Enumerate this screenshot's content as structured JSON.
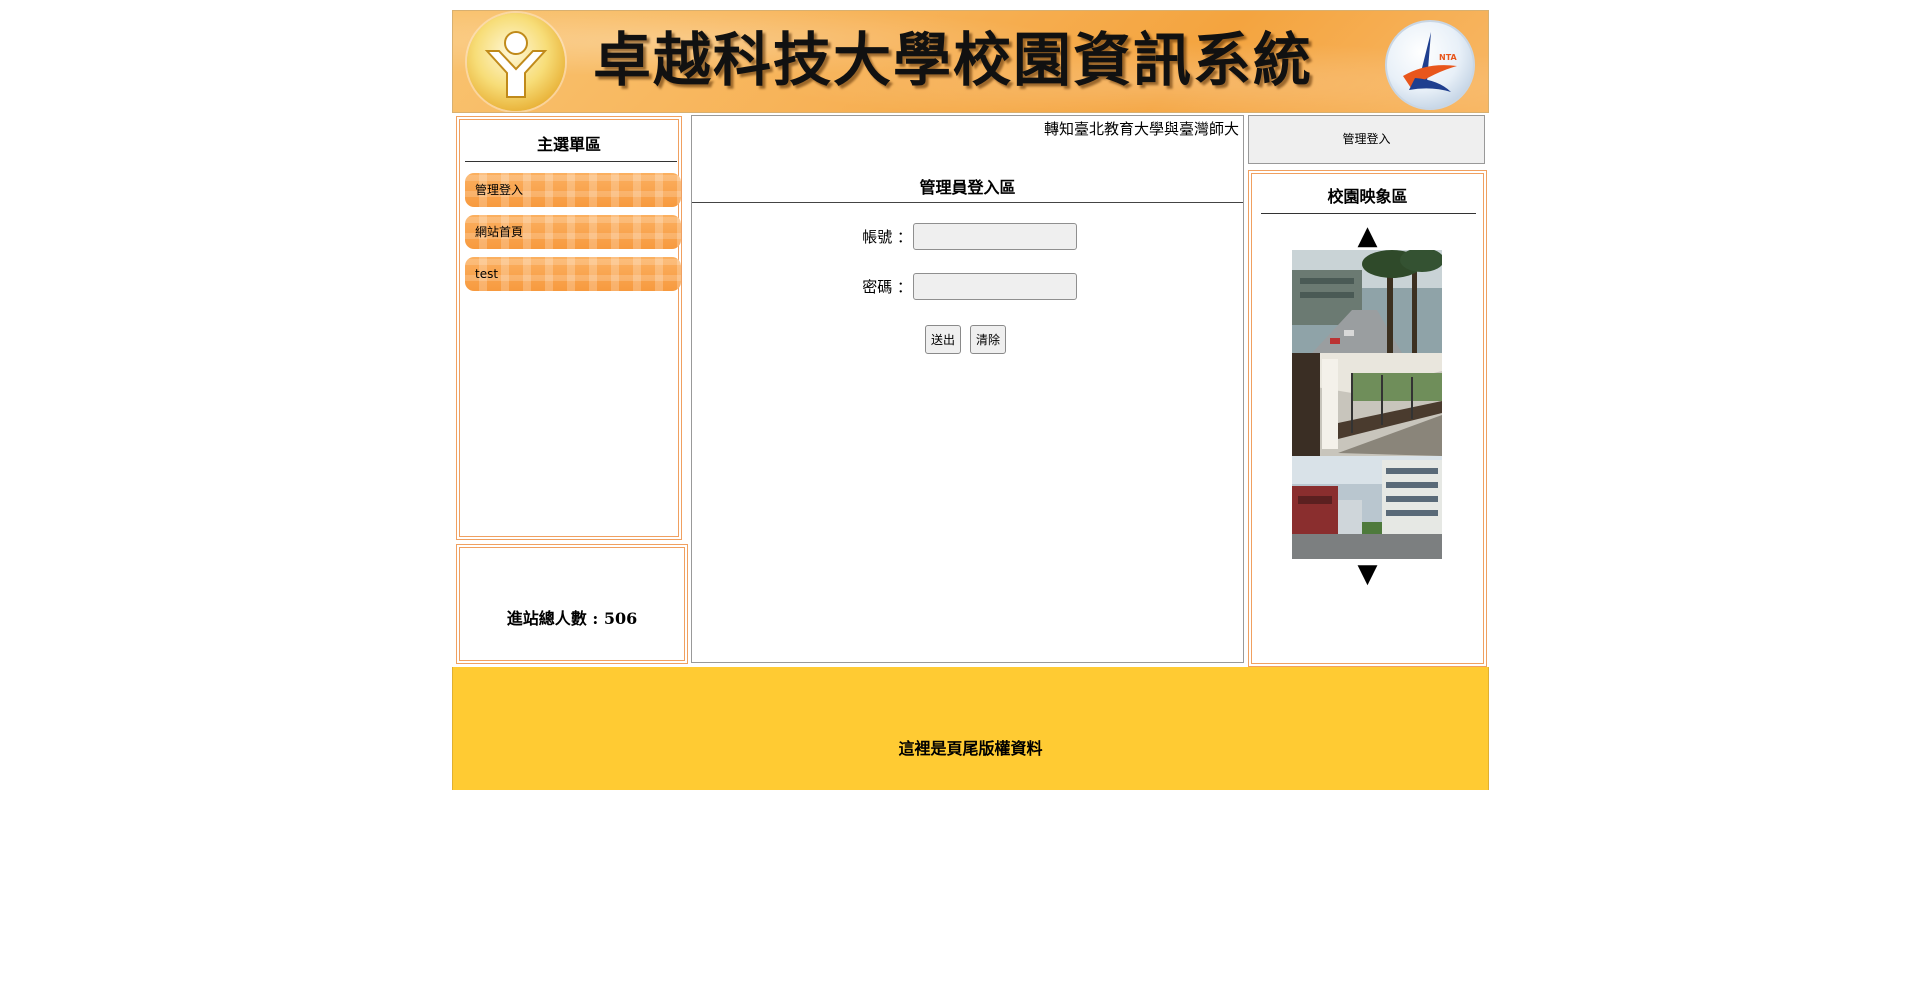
{
  "header": {
    "site_title": "卓越科技大學校園資訊系統",
    "logo_left": "school-emblem-icon",
    "logo_right": "partner-emblem-icon"
  },
  "menu": {
    "title": "主選單區",
    "items": [
      {
        "label": "管理登入"
      },
      {
        "label": "網站首頁"
      },
      {
        "label": "test"
      }
    ]
  },
  "visitor": {
    "label": "進站總人數 : 506"
  },
  "center": {
    "marquee": "轉知臺北教育大學與臺灣師大",
    "login_title": "管理員登入區",
    "account_label": "帳號 ：",
    "account_value": "",
    "password_label": "密碼 ：",
    "password_value": "",
    "submit_label": "送出",
    "clear_label": "清除"
  },
  "right": {
    "admin_login_label": "管理登入",
    "gallery_title": "校園映象區",
    "up_arrow": "▲",
    "down_arrow": "▼",
    "photos": [
      "campus-road-photo",
      "corridor-photo",
      "campus-building-photo"
    ]
  },
  "footer": {
    "text": "這裡是頁尾版權資料"
  },
  "colors": {
    "header_orange": "#f7b257",
    "menu_item_orange": "#f79a3f",
    "frame_border": "#f0a060",
    "footer_yellow": "#ffcb33"
  }
}
